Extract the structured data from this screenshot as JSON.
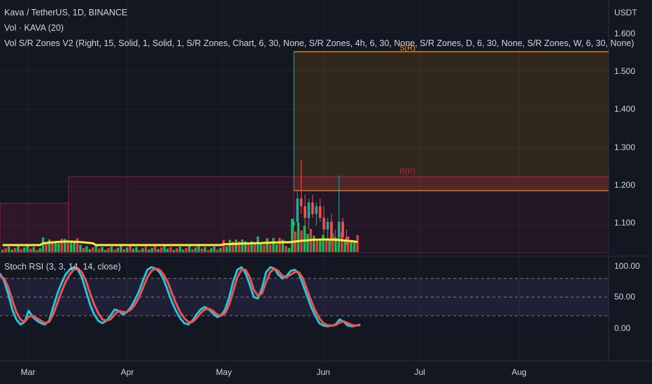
{
  "header": {
    "title": "Kava / TetherUS, 1D, BINANCE",
    "volume": "Vol · KAVA (20)",
    "sr_zones": "Vol S/R Zones V2 (Right, 15, Solid, 1, Solid, 1, S/R Zones, Chart, 6, 30, None, S/R Zones, 4h, 6, 30, None, S/R Zones, D, 6, 30, None, S/R Zones, W, 6, 30, None)",
    "rsi": "Stoch RSI (3, 3, 14, 14, close)"
  },
  "price_axis": {
    "currency": "USDT",
    "ticks": [
      "1.600",
      "1.500",
      "1.400",
      "1.300",
      "1.200",
      "1.100"
    ]
  },
  "rsi_axis": {
    "ticks": [
      "100.00",
      "50.00",
      "0.00"
    ]
  },
  "time_axis": {
    "labels": [
      "Mar",
      "Apr",
      "May",
      "Jun",
      "Jul",
      "Aug"
    ]
  },
  "zone_labels": {
    "upper": "S(R)",
    "lower": "R(R)"
  },
  "colors": {
    "background": "#131722",
    "grid": "#1e222d",
    "up": "#26a69a",
    "down": "#ef5350",
    "volume_up": "#22c55e",
    "volume_down": "#ef4444",
    "volume_ma": "#ffeb3b",
    "stoch_k": "#26c6da",
    "stoch_d": "#ef5350",
    "zone_orange": "#ff9800",
    "zone_red": "#e91e63"
  },
  "chart_data": [
    {
      "type": "candlestick",
      "title": "Kava / TetherUS, 1D, BINANCE",
      "ylabel": "USDT",
      "ylim": [
        1.03,
        1.65
      ],
      "x_ticks": [
        "Mar",
        "Apr",
        "May",
        "Jun",
        "Jul",
        "Aug"
      ],
      "zones": [
        {
          "label": "S(R)",
          "from": 1.18,
          "to": 1.55
        },
        {
          "label": "R(R)",
          "from": 1.18,
          "to": 1.22
        }
      ],
      "candles_visible": "late May – early Jun",
      "approx_range": {
        "low": 1.05,
        "high": 1.27
      }
    },
    {
      "type": "bar",
      "title": "Vol · KAVA (20)",
      "moving_average_length": 20
    },
    {
      "type": "line",
      "title": "Stoch RSI (3, 3, 14, 14, close)",
      "ylim": [
        0,
        100
      ],
      "bands": [
        20,
        50,
        80
      ],
      "series": [
        {
          "name": "%K",
          "values": [
            88,
            76,
            55,
            30,
            14,
            6,
            10,
            28,
            18,
            12,
            8,
            6,
            12,
            34,
            55,
            72,
            86,
            94,
            98,
            94,
            82,
            60,
            38,
            22,
            12,
            8,
            12,
            20,
            30,
            28,
            22,
            26,
            34,
            46,
            60,
            78,
            94,
            98,
            96,
            90,
            78,
            60,
            42,
            28,
            16,
            8,
            6,
            12,
            22,
            30,
            34,
            30,
            24,
            18,
            20,
            30,
            50,
            76,
            94,
            98,
            88,
            70,
            50,
            48,
            64,
            90,
            98,
            96,
            86,
            80,
            84,
            92,
            94,
            88,
            70,
            52,
            34,
            20,
            8,
            4,
            3,
            4,
            6,
            14,
            10,
            4,
            3,
            4,
            6
          ]
        },
        {
          "name": "%D",
          "values": [
            84,
            80,
            66,
            45,
            26,
            14,
            10,
            18,
            20,
            16,
            12,
            8,
            10,
            22,
            40,
            58,
            74,
            86,
            94,
            96,
            90,
            76,
            56,
            38,
            24,
            14,
            12,
            14,
            22,
            28,
            26,
            26,
            30,
            38,
            50,
            66,
            82,
            92,
            96,
            94,
            86,
            74,
            56,
            40,
            26,
            16,
            10,
            10,
            16,
            24,
            30,
            31,
            28,
            22,
            20,
            24,
            38,
            60,
            82,
            94,
            94,
            82,
            62,
            52,
            56,
            74,
            90,
            96,
            92,
            84,
            82,
            86,
            90,
            90,
            80,
            62,
            44,
            28,
            16,
            8,
            5,
            4,
            5,
            9,
            11,
            8,
            5,
            4,
            5
          ]
        }
      ]
    }
  ]
}
